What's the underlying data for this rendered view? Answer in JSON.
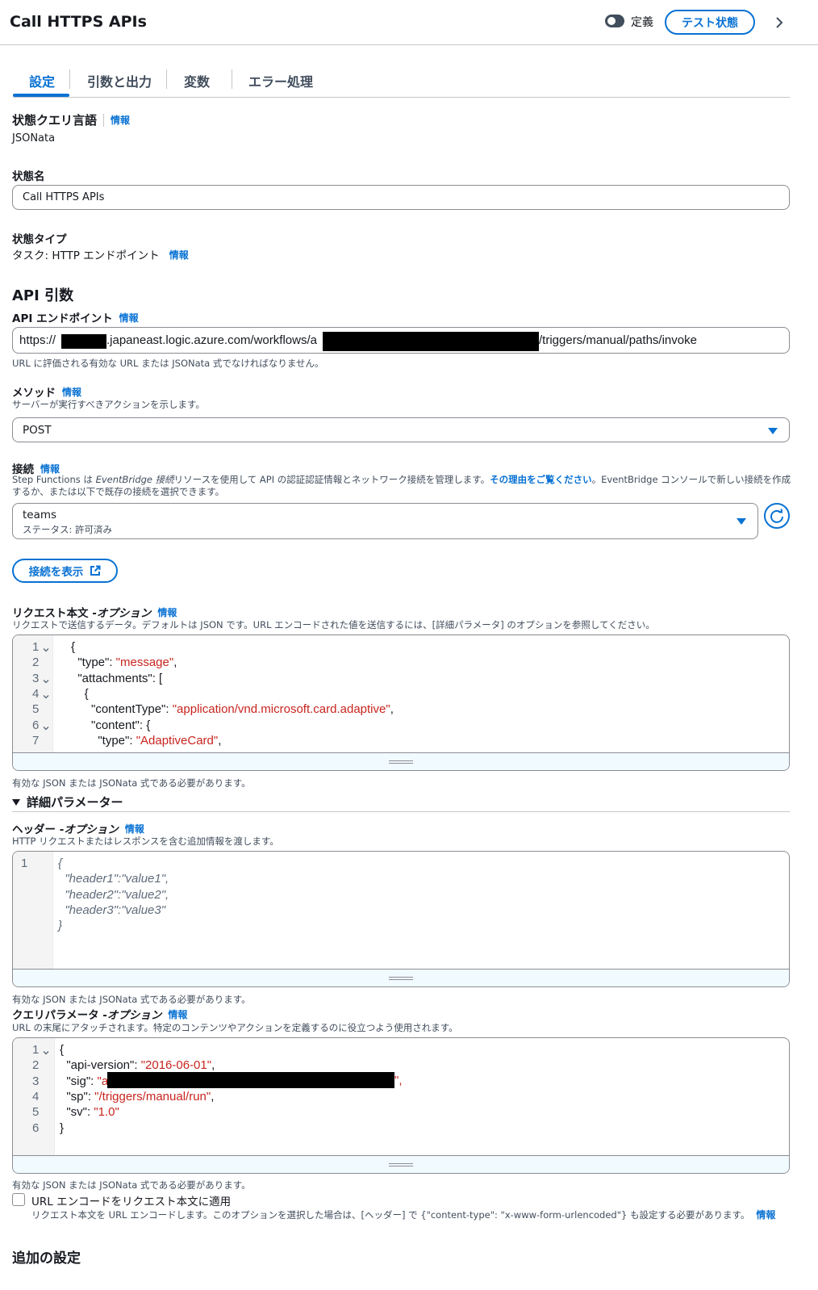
{
  "header": {
    "title": "Call HTTPS APIs",
    "toggle_label": "定義",
    "test_button": "テスト状態"
  },
  "tabs": [
    "設定",
    "引数と出力",
    "変数",
    "エラー処理"
  ],
  "info_label": "情報",
  "query_language": {
    "label": "状態クエリ言語",
    "value": "JSONata"
  },
  "state_name": {
    "label": "状態名",
    "value": "Call HTTPS APIs"
  },
  "state_type": {
    "label": "状態タイプ",
    "value": "タスク: HTTP エンドポイント"
  },
  "api_args": {
    "heading": "API 引数",
    "endpoint": {
      "label": "API エンドポイント",
      "prefix": "https://",
      "middle": ".japaneast.logic.azure.com/workflows/a",
      "suffix": "/triggers/manual/paths/invoke",
      "hint": "URL に評価される有効な URL または JSONata 式でなければなりません。"
    },
    "method": {
      "label": "メソッド",
      "desc": "サーバーが実行すべきアクションを示します。",
      "value": "POST"
    },
    "connection": {
      "label": "接続",
      "desc_1": "Step Functions は ",
      "desc_em": "EventBridge 接続",
      "desc_2": "リソースを使用して API の認証認証情報とネットワーク接続を管理します。",
      "desc_link": "その理由をご覧ください",
      "desc_3": "。EventBridge コンソールで新しい接続を作成",
      "desc_4": "するか、または以下で既存の接続を選択できます。",
      "value": "teams",
      "status": "ステータス: 許可済み",
      "view_button": "接続を表示"
    },
    "body": {
      "label": "リクエスト本文 - ",
      "label_em": "オプション",
      "desc": "リクエストで送信するデータ。デフォルトは JSON です。URL エンコードされた値を送信するには、[詳細パラメータ] のオプションを参照してください。",
      "lines": [
        {
          "n": "1",
          "fold": true,
          "key": "{",
          "val": "",
          "tail": ""
        },
        {
          "n": "2",
          "fold": false,
          "key": "  \"type\": ",
          "val": "\"message\"",
          "tail": ","
        },
        {
          "n": "3",
          "fold": true,
          "key": "  \"attachments\": [",
          "val": "",
          "tail": ""
        },
        {
          "n": "4",
          "fold": true,
          "key": "    {",
          "val": "",
          "tail": ""
        },
        {
          "n": "5",
          "fold": false,
          "key": "      \"contentType\": ",
          "val": "\"application/vnd.microsoft.card.adaptive\"",
          "tail": ","
        },
        {
          "n": "6",
          "fold": true,
          "key": "      \"content\": {",
          "val": "",
          "tail": ""
        },
        {
          "n": "7",
          "fold": false,
          "key": "        \"type\": ",
          "val": "\"AdaptiveCard\"",
          "tail": ","
        }
      ],
      "hint": "有効な JSON または JSONata 式である必要があります。"
    }
  },
  "advanced": {
    "heading": "詳細パラメーター",
    "headers": {
      "label": "ヘッダー - ",
      "label_em": "オプション",
      "desc": "HTTP リクエストまたはレスポンスを含む追加情報を渡します。",
      "placeholder_lines": [
        "{",
        "  \"header1\":\"value1\",",
        "  \"header2\":\"value2\",",
        "  \"header3\":\"value3\"",
        "}"
      ],
      "hint": "有効な JSON または JSONata 式である必要があります。"
    },
    "query": {
      "label": "クエリパラメータ - ",
      "label_em": "オプション",
      "desc": "URL の末尾にアタッチされます。特定のコンテンツやアクションを定義するのに役立つよう使用されます。",
      "lines": [
        {
          "n": "1",
          "fold": true,
          "key": "{",
          "val": "",
          "tail": ""
        },
        {
          "n": "2",
          "fold": false,
          "key": "  \"api-version\": ",
          "val": "\"2016-06-01\"",
          "tail": ","
        },
        {
          "n": "3",
          "fold": false,
          "key": "  \"sig\": ",
          "val": "\"a",
          "tail": ""
        },
        {
          "n": "4",
          "fold": false,
          "key": "  \"sp\": ",
          "val": "\"/triggers/manual/run\"",
          "tail": ","
        },
        {
          "n": "5",
          "fold": false,
          "key": "  \"sv\": ",
          "val": "\"1.0\"",
          "tail": ""
        },
        {
          "n": "6",
          "fold": false,
          "key": "}",
          "val": "",
          "tail": ""
        }
      ],
      "sig_end": "\",",
      "hint": "有効な JSON または JSONata 式である必要があります。"
    },
    "url_encode": {
      "label": "URL エンコードをリクエスト本文に適用",
      "desc": "リクエスト本文を URL エンコードします。このオプションを選択した場合は、[ヘッダー] で {\"content-type\": \"x-www-form-urlencoded\"} も設定する必要があります。"
    }
  },
  "additional": {
    "heading": "追加の設定"
  }
}
